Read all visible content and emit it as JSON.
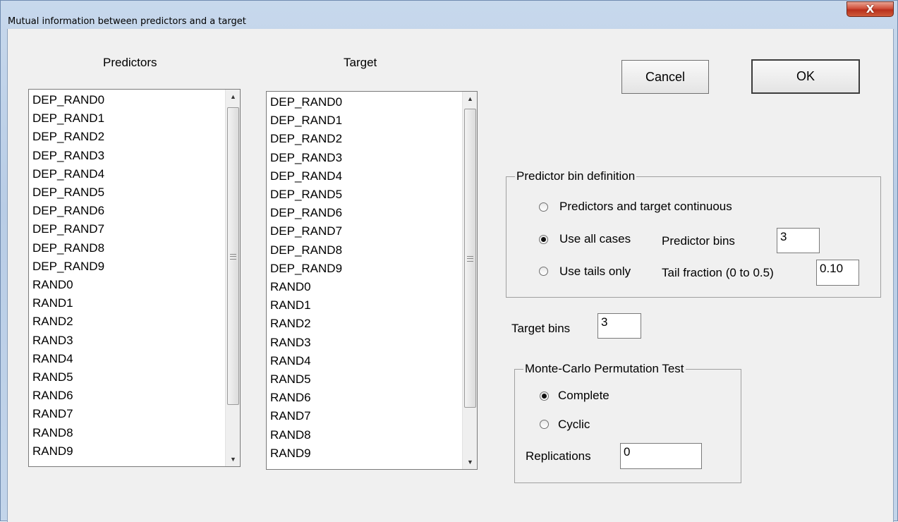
{
  "window": {
    "title": "Mutual information between predictors and a target",
    "close_label": "X"
  },
  "predictors": {
    "label": "Predictors",
    "items": [
      "DEP_RAND0",
      "DEP_RAND1",
      "DEP_RAND2",
      "DEP_RAND3",
      "DEP_RAND4",
      "DEP_RAND5",
      "DEP_RAND6",
      "DEP_RAND7",
      "DEP_RAND8",
      "DEP_RAND9",
      "RAND0",
      "RAND1",
      "RAND2",
      "RAND3",
      "RAND4",
      "RAND5",
      "RAND6",
      "RAND7",
      "RAND8",
      "RAND9"
    ]
  },
  "target": {
    "label": "Target",
    "items": [
      "DEP_RAND0",
      "DEP_RAND1",
      "DEP_RAND2",
      "DEP_RAND3",
      "DEP_RAND4",
      "DEP_RAND5",
      "DEP_RAND6",
      "DEP_RAND7",
      "DEP_RAND8",
      "DEP_RAND9",
      "RAND0",
      "RAND1",
      "RAND2",
      "RAND3",
      "RAND4",
      "RAND5",
      "RAND6",
      "RAND7",
      "RAND8",
      "RAND9"
    ]
  },
  "buttons": {
    "cancel": "Cancel",
    "ok": "OK"
  },
  "bin_definition": {
    "title": "Predictor bin definition",
    "option_continuous": "Predictors and target continuous",
    "option_all_cases": "Use all cases",
    "option_tails": "Use tails only",
    "selected": "all_cases",
    "predictor_bins_label": "Predictor bins",
    "predictor_bins_value": "3",
    "tail_fraction_label": "Tail fraction (0 to 0.5)",
    "tail_fraction_value": "0.10"
  },
  "target_bins": {
    "label": "Target bins",
    "value": "3"
  },
  "monte_carlo": {
    "title": "Monte-Carlo Permutation Test",
    "option_complete": "Complete",
    "option_cyclic": "Cyclic",
    "selected": "complete",
    "replications_label": "Replications",
    "replications_value": "0"
  }
}
